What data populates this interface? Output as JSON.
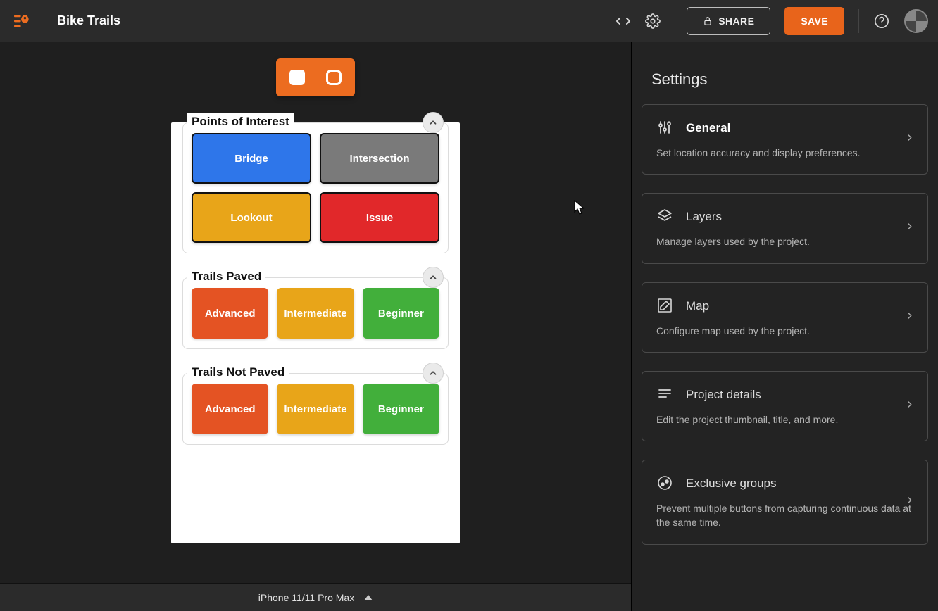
{
  "header": {
    "projectTitle": "Bike Trails",
    "shareLabel": "SHARE",
    "saveLabel": "SAVE"
  },
  "device": {
    "label": "iPhone 11/11 Pro Max"
  },
  "canvas": {
    "groups": [
      {
        "title": "Points of Interest",
        "layout": "grid2",
        "tiles": [
          {
            "label": "Bridge",
            "colorClass": "c-blue",
            "bordered": true
          },
          {
            "label": "Intersection",
            "colorClass": "c-gray",
            "bordered": true
          },
          {
            "label": "Lookout",
            "colorClass": "c-amber",
            "bordered": true
          },
          {
            "label": "Issue",
            "colorClass": "c-red",
            "bordered": true
          }
        ]
      },
      {
        "title": "Trails Paved",
        "layout": "grid3",
        "tiles": [
          {
            "label": "Advanced",
            "colorClass": "c-orange",
            "bordered": false
          },
          {
            "label": "Intermediate",
            "colorClass": "c-amber",
            "bordered": false
          },
          {
            "label": "Beginner",
            "colorClass": "c-green",
            "bordered": false
          }
        ]
      },
      {
        "title": "Trails Not Paved",
        "layout": "grid3",
        "tiles": [
          {
            "label": "Advanced",
            "colorClass": "c-orange",
            "bordered": false
          },
          {
            "label": "Intermediate",
            "colorClass": "c-amber",
            "bordered": false
          },
          {
            "label": "Beginner",
            "colorClass": "c-green",
            "bordered": false
          }
        ]
      }
    ]
  },
  "settings": {
    "title": "Settings",
    "cards": [
      {
        "title": "General",
        "desc": "Set location accuracy and display preferences.",
        "icon": "sliders",
        "active": true
      },
      {
        "title": "Layers",
        "desc": "Manage layers used by the project.",
        "icon": "layers",
        "active": false
      },
      {
        "title": "Map",
        "desc": "Configure map used by the project.",
        "icon": "mapedit",
        "active": false
      },
      {
        "title": "Project details",
        "desc": "Edit the project thumbnail, title, and more.",
        "icon": "details",
        "active": false
      },
      {
        "title": "Exclusive groups",
        "desc": "Prevent multiple buttons from capturing continuous data at the same time.",
        "icon": "exclusive",
        "active": false
      }
    ]
  }
}
